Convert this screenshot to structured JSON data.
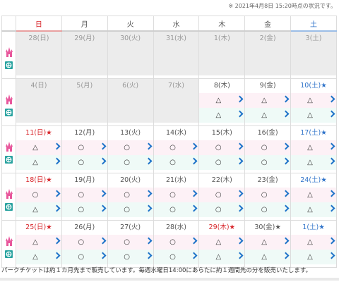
{
  "status_text": "※ 2021年4月8日 15:20時点の状況です。",
  "weekdays": [
    "日",
    "月",
    "火",
    "水",
    "木",
    "金",
    "土"
  ],
  "weeks": [
    {
      "days": [
        {
          "label": "28(日)",
          "past": true
        },
        {
          "label": "29(月)",
          "past": true
        },
        {
          "label": "30(火)",
          "past": true
        },
        {
          "label": "31(水)",
          "past": true
        },
        {
          "label": "1(木)",
          "past": true
        },
        {
          "label": "2(金)",
          "past": true
        },
        {
          "label": "3(土)",
          "past": true
        }
      ]
    },
    {
      "days": [
        {
          "label": "4(日)",
          "past": true
        },
        {
          "label": "5(月)",
          "past": true
        },
        {
          "label": "6(火)",
          "past": true
        },
        {
          "label": "7(水)",
          "past": true
        },
        {
          "label": "8(木)",
          "past": false,
          "land": "△",
          "sea": "△"
        },
        {
          "label": "9(金)",
          "past": false,
          "land": "△",
          "sea": "△"
        },
        {
          "label": "10(土)★",
          "past": false,
          "color": "blue",
          "land": "△",
          "sea": "△"
        }
      ]
    },
    {
      "days": [
        {
          "label": "11(日)★",
          "past": false,
          "color": "red",
          "land": "△",
          "sea": "△"
        },
        {
          "label": "12(月)",
          "past": false,
          "land": "○",
          "sea": "○"
        },
        {
          "label": "13(火)",
          "past": false,
          "land": "○",
          "sea": "○"
        },
        {
          "label": "14(水)",
          "past": false,
          "land": "○",
          "sea": "○"
        },
        {
          "label": "15(木)",
          "past": false,
          "land": "○",
          "sea": "○"
        },
        {
          "label": "16(金)",
          "past": false,
          "land": "○",
          "sea": "○"
        },
        {
          "label": "17(土)★",
          "past": false,
          "color": "blue",
          "land": "△",
          "sea": "△"
        }
      ]
    },
    {
      "days": [
        {
          "label": "18(日)★",
          "past": false,
          "color": "red",
          "land": "○",
          "sea": "△"
        },
        {
          "label": "19(月)",
          "past": false,
          "land": "○",
          "sea": "○"
        },
        {
          "label": "20(火)",
          "past": false,
          "land": "○",
          "sea": "○"
        },
        {
          "label": "21(水)",
          "past": false,
          "land": "○",
          "sea": "○"
        },
        {
          "label": "22(木)",
          "past": false,
          "land": "○",
          "sea": "○"
        },
        {
          "label": "23(金)",
          "past": false,
          "land": "○",
          "sea": "○"
        },
        {
          "label": "24(土)★",
          "past": false,
          "color": "blue",
          "land": "△",
          "sea": "△"
        }
      ]
    },
    {
      "days": [
        {
          "label": "25(日)★",
          "past": false,
          "color": "red",
          "land": "△",
          "sea": "△"
        },
        {
          "label": "26(月)",
          "past": false,
          "land": "○",
          "sea": "○"
        },
        {
          "label": "27(火)",
          "past": false,
          "land": "○",
          "sea": "○"
        },
        {
          "label": "28(水)",
          "past": false,
          "land": "○",
          "sea": "○"
        },
        {
          "label": "29(木)★",
          "past": false,
          "color": "red",
          "land": "△",
          "sea": "△"
        },
        {
          "label": "30(金)★",
          "past": false,
          "land": "△",
          "sea": "△"
        },
        {
          "label": "1(土)★",
          "past": false,
          "color": "blue",
          "land": "△",
          "sea": "△"
        }
      ]
    }
  ],
  "footer_note": "パークチケットは約１カ月先まで販売しています。毎週水曜日14:00にあらたに約１週間先の分を販売いたします。",
  "colors": {
    "sunday": "#d8262b",
    "saturday": "#2f73c9",
    "land_row": "#fdf1f6",
    "sea_row": "#effaf7",
    "past": "#ececec",
    "chevron": "#1e73c9"
  },
  "icons": {
    "land": "castle-icon",
    "sea": "sea-icon",
    "more": "chevron-right-icon"
  }
}
